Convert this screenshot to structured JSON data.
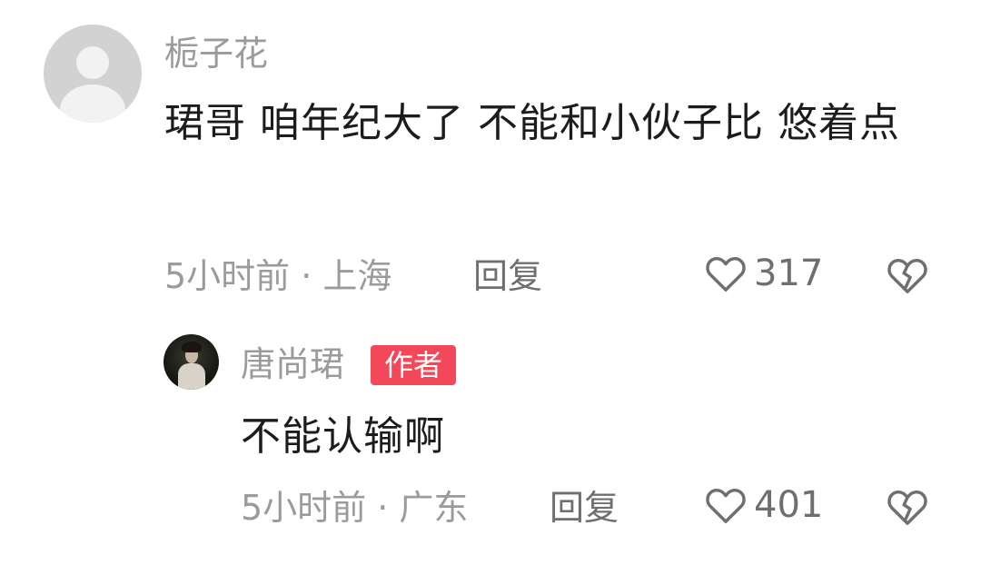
{
  "comments": [
    {
      "username": "栀子花",
      "text": "珺哥 咱年纪大了 不能和小伙子比 悠着点",
      "meta": "5小时前 · 上海",
      "reply_label": "回复",
      "likes": "317",
      "avatar_icon": "default-user-avatar-icon"
    },
    {
      "username": "唐尚珺",
      "badge": "作者",
      "text": "不能认输啊",
      "meta": "5小时前 · 广东",
      "reply_label": "回复",
      "likes": "401",
      "avatar_icon": "user-photo-avatar"
    }
  ],
  "colors": {
    "badge_bg": "#f2485a",
    "text_primary": "#1c1c1c",
    "text_secondary": "#9b9b9b"
  },
  "icons": {
    "like": "heart-outline-icon",
    "dislike": "broken-heart-icon"
  }
}
